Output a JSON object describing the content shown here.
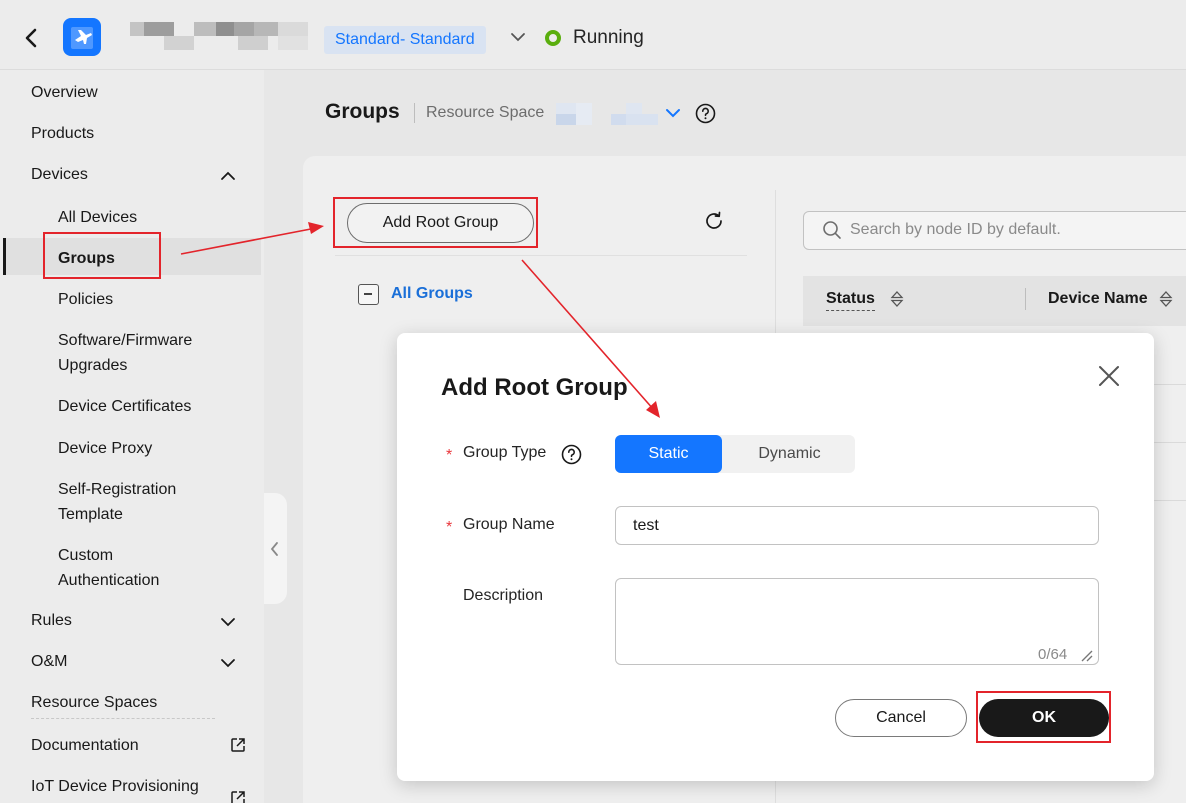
{
  "header": {
    "edition": "Standard- Standard",
    "status": "Running",
    "colors": {
      "accent": "#1476ff",
      "status_ok": "#5aae0e"
    }
  },
  "sidebar": {
    "items": [
      {
        "label": "Overview"
      },
      {
        "label": "Products"
      },
      {
        "label": "Devices",
        "expanded": true
      },
      {
        "label": "Rules"
      },
      {
        "label": "O&M"
      },
      {
        "label": "Resource Spaces"
      },
      {
        "label": "Documentation",
        "icon": "external-link-icon"
      },
      {
        "label": "IoT Device Provisioning",
        "icon": "external-link-icon"
      }
    ],
    "device_items": [
      {
        "label": "All Devices"
      },
      {
        "label": "Groups",
        "active": true
      },
      {
        "label": "Policies"
      },
      {
        "label": "Software/Firmware Upgrades",
        "lines": [
          "Software/Firmware",
          "Upgrades"
        ]
      },
      {
        "label": "Device Certificates"
      },
      {
        "label": "Device Proxy"
      },
      {
        "label": "Self-Registration Template",
        "lines": [
          "Self-Registration",
          "Template"
        ]
      },
      {
        "label": "Custom Authentication",
        "lines": [
          "Custom",
          "Authentication"
        ]
      }
    ]
  },
  "page": {
    "title": "Groups",
    "resource_space_label": "Resource Space"
  },
  "tree": {
    "add_root_label": "Add Root Group",
    "root_node_label": "All Groups"
  },
  "search": {
    "placeholder": "Search by node ID by default."
  },
  "table": {
    "columns": [
      "Status",
      "Device Name"
    ]
  },
  "dialog": {
    "title": "Add Root Group",
    "group_type_label": "Group Type",
    "group_type_options": [
      "Static",
      "Dynamic"
    ],
    "group_type_selected": "Static",
    "group_name_label": "Group Name",
    "group_name_value": "test",
    "description_label": "Description",
    "description_counter": "0/64",
    "cancel_label": "Cancel",
    "ok_label": "OK"
  },
  "annotation_color": "#e3242b"
}
